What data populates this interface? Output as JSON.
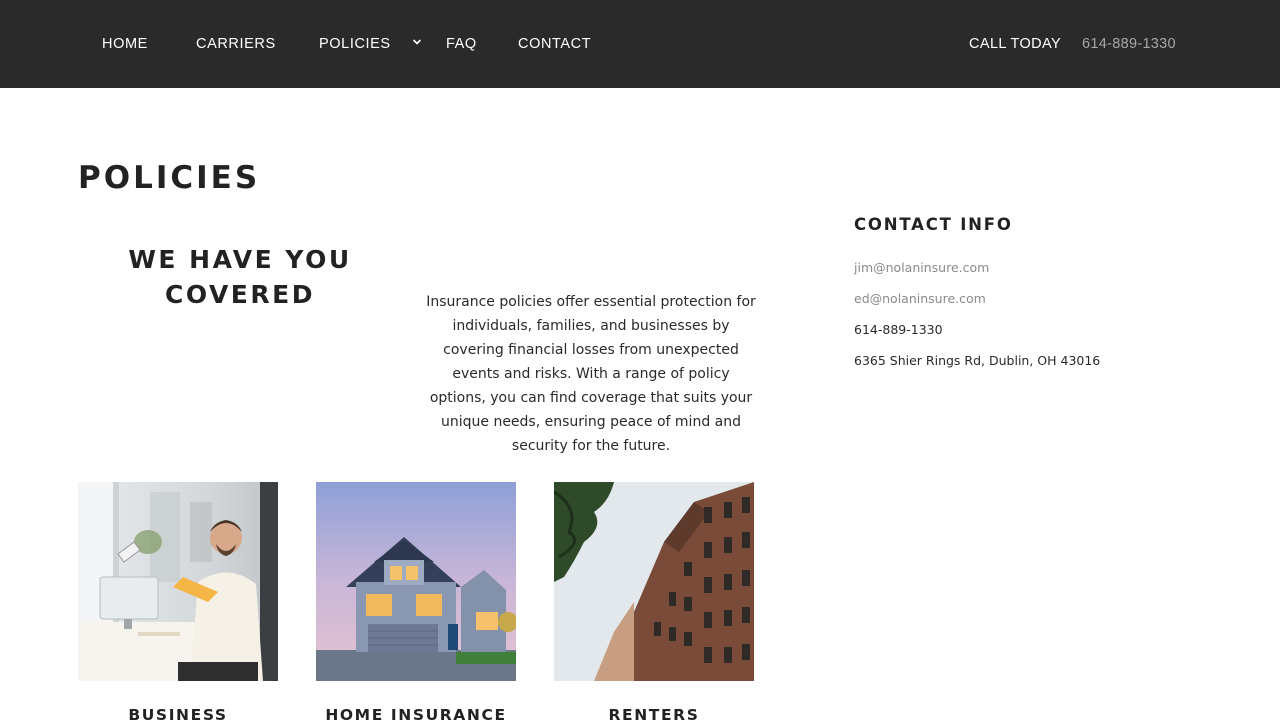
{
  "nav": {
    "items": [
      {
        "label": "HOME"
      },
      {
        "label": "CARRIERS"
      },
      {
        "label": "POLICIES"
      },
      {
        "label": "FAQ"
      },
      {
        "label": "CONTACT"
      }
    ],
    "call_label": "CALL TODAY",
    "call_phone": "614-889-1330",
    "dropdown_icon": "chevron-down-icon"
  },
  "main": {
    "title": "POLICIES",
    "heading_line1": "WE HAVE YOU",
    "heading_line2": "COVERED",
    "intro": "Insurance policies offer essential protection for individuals, families, and businesses by covering financial losses from unexpected events and risks. With a range of policy options, you can find coverage that suits your unique needs, ensuring peace of mind and security for the future."
  },
  "contact": {
    "title": "CONTACT INFO",
    "email1": "jim@nolaninsure.com",
    "email2": "ed@nolaninsure.com",
    "phone": "614-889-1330",
    "address": "6365 Shier Rings Rd, Dublin, OH 43016"
  },
  "cards": [
    {
      "label": "BUSINESS"
    },
    {
      "label": "HOME INSURANCE"
    },
    {
      "label": "RENTERS"
    }
  ],
  "colors": {
    "nav_bg": "#2a2a2a",
    "nav_text": "#ffffff",
    "muted_text": "#8a8a8a",
    "heading": "#222222"
  }
}
